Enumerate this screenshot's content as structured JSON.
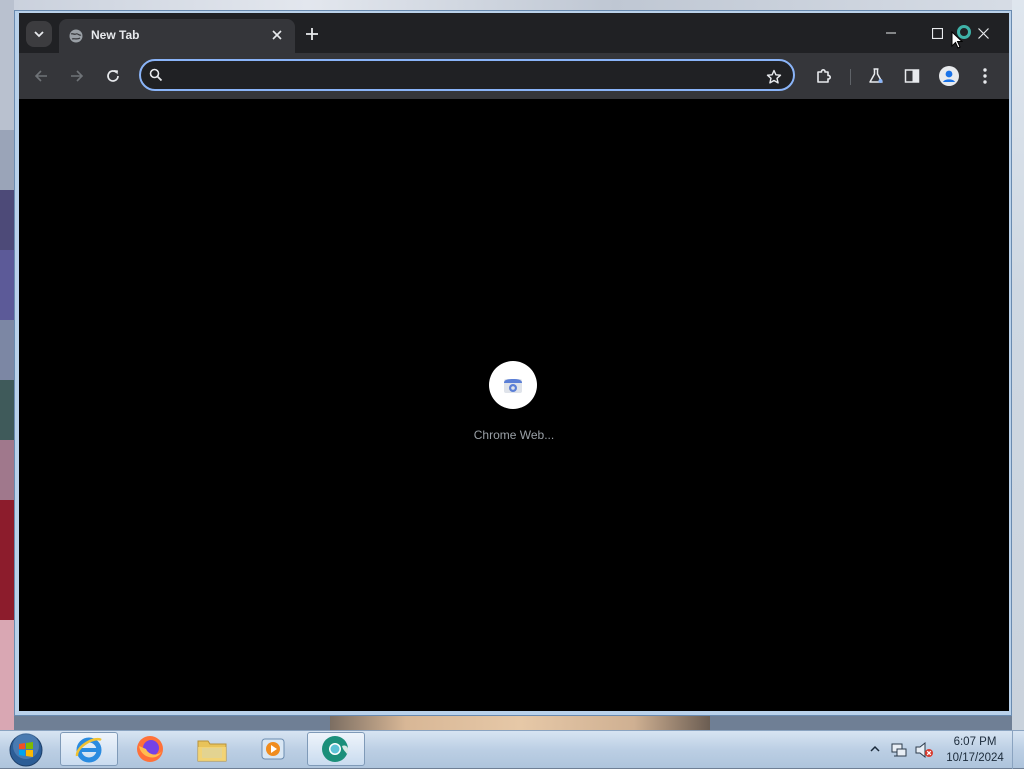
{
  "browser": {
    "tab": {
      "title": "New Tab"
    },
    "omnibox": {
      "value": "",
      "placeholder": ""
    }
  },
  "content": {
    "loading_label": "Chrome Web..."
  },
  "taskbar": {
    "apps": [
      "internet-explorer",
      "firefox",
      "file-explorer",
      "media-player",
      "chrome-canary"
    ],
    "clock": {
      "time": "6:07 PM",
      "date": "10/17/2024"
    }
  },
  "colors": {
    "chrome_bg": "#202124",
    "toolbar_bg": "#35363a",
    "omnibox_focus": "#8ab4f8",
    "content_bg": "#000000"
  }
}
